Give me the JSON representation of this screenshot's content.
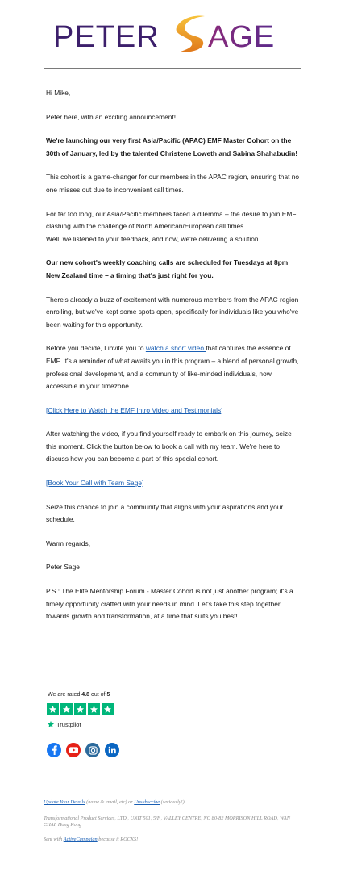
{
  "logo": {
    "text_left": "PETER",
    "text_right": "AGE"
  },
  "email": {
    "greeting": "Hi Mike,",
    "intro": "Peter here, with an exciting announcement!",
    "headline": "We're launching our very first Asia/Pacific (APAC) EMF Master Cohort on the 30th of January, led by the talented Christene Loweth and Sabina Shahabudin!",
    "para_gamechanger": "This cohort is a game-changer for our members in the APAC region, ensuring that no one misses out due to inconvenient call times.",
    "para_dilemma_1": "For far too long, our Asia/Pacific members faced a dilemma – the desire to join EMF clashing with the challenge of North American/European call times.",
    "para_dilemma_2": "Well, we listened to your feedback, and now, we're delivering a solution.",
    "schedule": "Our new cohort's weekly coaching calls are scheduled for Tuesdays at 8pm New Zealand time – a timing that's just right for you.",
    "para_buzz": "There's already a buzz of excitement with numerous members from the APAC region enrolling, but we've kept some spots open, specifically for individuals like you who've been waiting for this opportunity.",
    "para_decide_before": "Before you decide, I invite you to ",
    "para_decide_link": "watch a short video ",
    "para_decide_after": "that captures the essence of EMF. It's a reminder of what awaits you in this program – a blend of personal growth, professional development, and a community of like-minded individuals, now accessible in your timezone.",
    "link_video": "[Click Here to Watch the EMF Intro Video and Testimonials]",
    "para_after_video": "After watching the video, if you find yourself ready to embark on this journey, seize this moment. Click the button below to book a call with my team. We're here to discuss how you can become a part of this special cohort.",
    "link_book": "[Book Your Call with Team Sage]",
    "para_seize": "Seize this chance to join a community that aligns with your aspirations and your schedule.",
    "closing": "Warm regards,",
    "signature": "Peter Sage",
    "ps": "P.S.: The Elite Mentorship Forum - Master Cohort is not just another program; it's a timely opportunity crafted with your needs in mind. Let's take this step together towards growth and transformation, at a time that suits you best!"
  },
  "rating": {
    "prefix": "We are rated",
    "score": "4.8",
    "middle": "out of",
    "max": "5",
    "stars_filled": 5,
    "brand": "Trustpilot"
  },
  "social": [
    {
      "name": "facebook",
      "color": "#1877f2"
    },
    {
      "name": "youtube",
      "color": "#e62117"
    },
    {
      "name": "instagram",
      "color": "#2c6a9c"
    },
    {
      "name": "linkedin",
      "color": "#0a66c2"
    }
  ],
  "footer": {
    "update_link": "Update Your Details",
    "update_note": "(name & email, etc) or",
    "unsubscribe_link": "Unsubscribe",
    "unsubscribe_note": "(seriously!)",
    "address": "Transformational Product Services, LTD., UNIT 501, 5/F., VALLEY CENTRE, NO 80-82 MORRISON HILL ROAD, WAN CHAI, Hong Kong",
    "sent_prefix": "Sent with",
    "sent_link": "ActiveCampaign",
    "sent_suffix": "because it ROCKS!"
  },
  "colors": {
    "logo_purple": "#3c1f6b",
    "logo_gold": "#f4a820",
    "link": "#1a5fb4",
    "trustpilot_green": "#00b67a"
  }
}
